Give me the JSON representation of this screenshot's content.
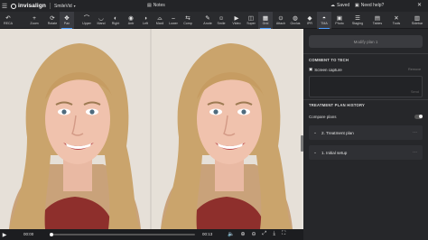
{
  "topbar": {
    "app_name": "SmileVid",
    "logo_text": "invisalign",
    "notes_label": "Notes",
    "saved_label": "Saved",
    "help_label": "Need help?"
  },
  "toolbar": {
    "tools": [
      {
        "label": "RECA",
        "icon": "history-icon"
      },
      {
        "label": "Zoom",
        "icon": "zoom-icon"
      },
      {
        "label": "Rotate",
        "icon": "rotate-icon"
      },
      {
        "label": "Pan",
        "icon": "pan-icon"
      },
      {
        "label": "Upper",
        "icon": "upper-jaw-icon"
      },
      {
        "label": "Mand",
        "icon": "mandible-icon"
      },
      {
        "label": "Right",
        "icon": "right-view-icon"
      },
      {
        "label": "Antr",
        "icon": "anterior-view-icon"
      },
      {
        "label": "Left",
        "icon": "left-view-icon"
      },
      {
        "label": "Maxil",
        "icon": "maxilla-icon"
      },
      {
        "label": "Lower",
        "icon": "lower-jaw-icon"
      },
      {
        "label": "Comp",
        "icon": "compare-icon"
      },
      {
        "label": "Anote",
        "icon": "annotate-icon"
      },
      {
        "label": "Smile",
        "icon": "smile-icon"
      },
      {
        "label": "Video",
        "icon": "video-icon"
      },
      {
        "label": "Super",
        "icon": "superimpose-icon"
      },
      {
        "label": "Grid",
        "icon": "grid-icon"
      },
      {
        "label": "Attach",
        "icon": "attachment-icon"
      },
      {
        "label": "Occlus",
        "icon": "occlusion-icon"
      },
      {
        "label": "IPR",
        "icon": "ipr-icon"
      },
      {
        "label": "TMA",
        "icon": "tma-icon"
      },
      {
        "label": "Photo",
        "icon": "photo-icon"
      },
      {
        "label": "Staging",
        "icon": "staging-icon"
      },
      {
        "label": "Tables",
        "icon": "tables-icon"
      },
      {
        "label": "Tools",
        "icon": "tools-icon"
      },
      {
        "label": "Sidebar",
        "icon": "sidebar-icon"
      }
    ]
  },
  "playback": {
    "current_time": "00:00",
    "end_time": "00:13"
  },
  "panel": {
    "modify_button": "Modify plan 1",
    "comment_title": "COMMENT TO TECH",
    "screen_capture_label": "Screen capture",
    "remove_label": "Remove",
    "send_label": "Send",
    "history_title": "TREATMENT PLAN HISTORY",
    "compare_label": "Compare plans",
    "plans": [
      {
        "label": "2. Treatment plan"
      },
      {
        "label": "1. Initial setup"
      }
    ]
  }
}
